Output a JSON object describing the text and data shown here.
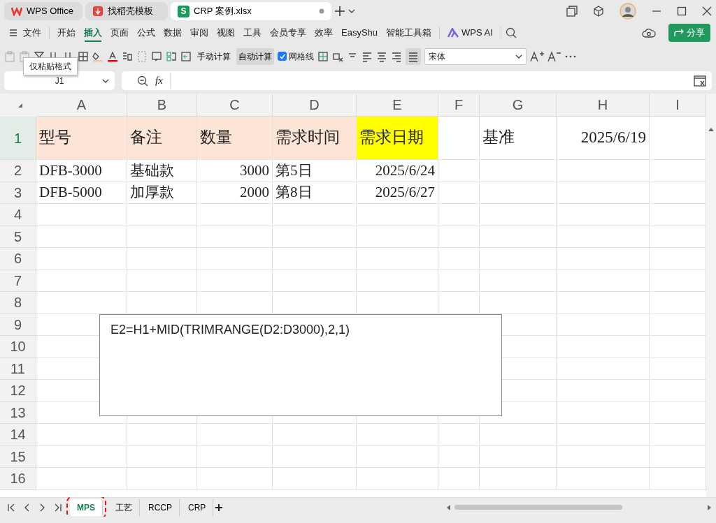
{
  "title_tabs": [
    {
      "label": "WPS Office",
      "kind": "wps",
      "selected": false,
      "modified": false
    },
    {
      "label": "找稻壳模板",
      "kind": "docer",
      "selected": false,
      "modified": false
    },
    {
      "label": "CRP 案例.xlsx",
      "kind": "sheet",
      "icon_text": "S",
      "selected": true,
      "modified": true
    }
  ],
  "menu": {
    "file": "文件",
    "items": [
      {
        "label": "开始",
        "selected": false
      },
      {
        "label": "插入",
        "selected": true
      },
      {
        "label": "页面",
        "selected": false
      },
      {
        "label": "公式",
        "selected": false
      },
      {
        "label": "数据",
        "selected": false
      },
      {
        "label": "审阅",
        "selected": false
      },
      {
        "label": "视图",
        "selected": false
      },
      {
        "label": "工具",
        "selected": false
      },
      {
        "label": "会员专享",
        "selected": false
      },
      {
        "label": "效率",
        "selected": false
      },
      {
        "label": "EasyShu",
        "selected": false
      },
      {
        "label": "智能工具箱",
        "selected": false
      }
    ],
    "ai": "WPS AI",
    "share": "分享"
  },
  "toolbar": {
    "calc_buttons": [
      {
        "label": "手动计算",
        "selected": false
      },
      {
        "label": "自动计算",
        "selected": true
      }
    ],
    "gridlines": {
      "label": "网格线",
      "checked": true
    },
    "font": "宋体"
  },
  "tooltip": "仅粘贴格式",
  "formula_bar": {
    "name_box": "J1",
    "fx": "fx"
  },
  "sheet": {
    "columns": [
      "A",
      "B",
      "C",
      "D",
      "E",
      "F",
      "G",
      "H",
      "I"
    ],
    "rows": [
      {
        "number": "1",
        "selected": true,
        "cells": [
          {
            "text": "型号",
            "color": "#fce4d6"
          },
          {
            "text": "备注",
            "color": "#fce4d6"
          },
          {
            "text": "数量",
            "color": "#fce4d6"
          },
          {
            "text": "需求时间",
            "color": "#fce4d6"
          },
          {
            "text": "需求日期",
            "color": "#ffff00"
          },
          null,
          {
            "text": "基准"
          },
          {
            "text": "2025/6/19",
            "kind": "number"
          },
          null
        ]
      },
      {
        "number": "2",
        "selected": false,
        "cells": [
          {
            "text": "DFB-3000"
          },
          {
            "text": "基础款"
          },
          {
            "text": "3000",
            "kind": "number"
          },
          {
            "text": "第5日"
          },
          {
            "text": "2025/6/24",
            "kind": "number"
          },
          null,
          null,
          null,
          null
        ]
      },
      {
        "number": "3",
        "selected": false,
        "cells": [
          {
            "text": "DFB-5000"
          },
          {
            "text": "加厚款"
          },
          {
            "text": "2000",
            "kind": "number"
          },
          {
            "text": "第8日"
          },
          {
            "text": "2025/6/27",
            "kind": "number"
          },
          null,
          null,
          null,
          null
        ]
      },
      {
        "number": "4",
        "selected": false
      },
      {
        "number": "5",
        "selected": false
      },
      {
        "number": "6",
        "selected": false
      },
      {
        "number": "7",
        "selected": false
      },
      {
        "number": "8",
        "selected": false
      },
      {
        "number": "9",
        "selected": false
      },
      {
        "number": "10",
        "selected": false
      },
      {
        "number": "11",
        "selected": false
      },
      {
        "number": "12",
        "selected": false
      },
      {
        "number": "13",
        "selected": false
      },
      {
        "number": "14",
        "selected": false
      },
      {
        "number": "15",
        "selected": false
      },
      {
        "number": "16",
        "selected": false
      }
    ]
  },
  "text_box": "E2=H1+MID(TRIMRANGE(D2:D3000),2,1)",
  "sheet_tabs": [
    {
      "label": "MPS",
      "selected": true
    },
    {
      "label": "工艺",
      "selected": false
    },
    {
      "label": "RCCP",
      "selected": false
    },
    {
      "label": "CRP",
      "selected": false
    }
  ]
}
